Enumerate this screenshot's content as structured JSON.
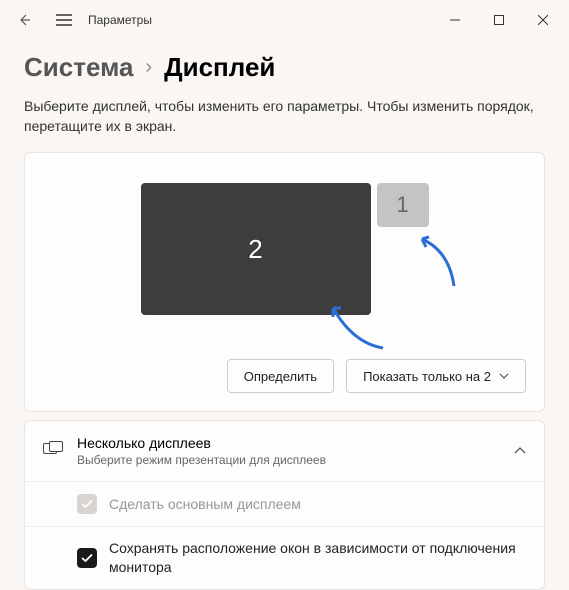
{
  "titlebar": {
    "back": "←",
    "title": "Параметры"
  },
  "breadcrumb": {
    "parent": "Система",
    "sep": "›",
    "current": "Дисплей"
  },
  "instruction": "Выберите дисплей, чтобы изменить его параметры. Чтобы изменить порядок, перетащите их в экран.",
  "monitors": {
    "primary": "2",
    "secondary": "1"
  },
  "buttons": {
    "identify": "Определить",
    "projection": "Показать только на 2"
  },
  "section": {
    "title": "Несколько дисплеев",
    "subtitle": "Выберите режим презентации для дисплеев"
  },
  "options": {
    "make_main": "Сделать основным дисплеем",
    "remember_layout": "Сохранять расположение окон в зависимости от подключения монитора"
  }
}
